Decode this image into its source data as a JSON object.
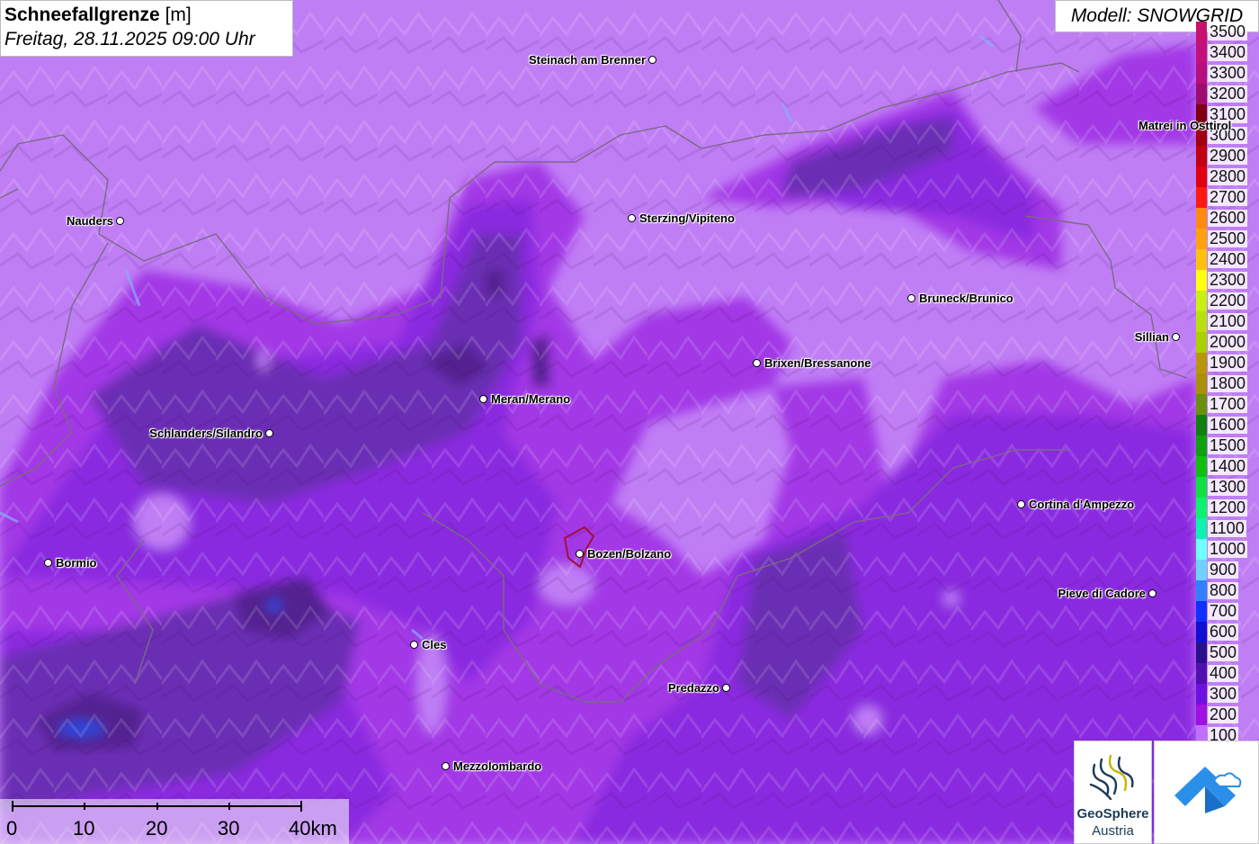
{
  "title": {
    "bold": "Schneefallgrenze",
    "unit": " [m]",
    "datetime": "Freitag, 28.11.2025 09:00 Uhr"
  },
  "model": "Modell: SNOWGRID",
  "legend": [
    {
      "label": "3500",
      "color": "#c8106e"
    },
    {
      "label": "3400",
      "color": "#c4107a"
    },
    {
      "label": "3300",
      "color": "#b60e7c"
    },
    {
      "label": "3200",
      "color": "#9c0c6e"
    },
    {
      "label": "3100",
      "color": "#7e0010"
    },
    {
      "label": "3000",
      "color": "#a00010"
    },
    {
      "label": "2900",
      "color": "#c00010"
    },
    {
      "label": "2800",
      "color": "#e00010"
    },
    {
      "label": "2700",
      "color": "#ff1a10"
    },
    {
      "label": "2600",
      "color": "#ff8a10"
    },
    {
      "label": "2500",
      "color": "#ffa010"
    },
    {
      "label": "2400",
      "color": "#ffc010"
    },
    {
      "label": "2300",
      "color": "#ffff10"
    },
    {
      "label": "2200",
      "color": "#c8f010"
    },
    {
      "label": "2100",
      "color": "#b8e010"
    },
    {
      "label": "2000",
      "color": "#aad000"
    },
    {
      "label": "1900",
      "color": "#b8960a"
    },
    {
      "label": "1800",
      "color": "#a8900a"
    },
    {
      "label": "1700",
      "color": "#6a9010"
    },
    {
      "label": "1600",
      "color": "#108010"
    },
    {
      "label": "1500",
      "color": "#10a010"
    },
    {
      "label": "1400",
      "color": "#10c010"
    },
    {
      "label": "1300",
      "color": "#10e040"
    },
    {
      "label": "1200",
      "color": "#10f070"
    },
    {
      "label": "1100",
      "color": "#10f0b0"
    },
    {
      "label": "1000",
      "color": "#70ffff"
    },
    {
      "label": "900",
      "color": "#70d0ff"
    },
    {
      "label": "800",
      "color": "#3080ff"
    },
    {
      "label": "700",
      "color": "#1030ff"
    },
    {
      "label": "600",
      "color": "#1010d0"
    },
    {
      "label": "500",
      "color": "#2a108a"
    },
    {
      "label": "400",
      "color": "#5010b0"
    },
    {
      "label": "300",
      "color": "#7010e0"
    },
    {
      "label": "200",
      "color": "#a010e0"
    },
    {
      "label": "100",
      "color": "#c070ff"
    }
  ],
  "cities": [
    {
      "name": "Steinach am Brenner",
      "label_side": "left"
    },
    {
      "name": "Nauders",
      "label_side": "left"
    },
    {
      "name": "Sterzing/Vipiteno",
      "label_side": "right"
    },
    {
      "name": "Bruneck/Brunico",
      "label_side": "right"
    },
    {
      "name": "Matrei in Osttirol",
      "label_side": "left"
    },
    {
      "name": "Sillian",
      "label_side": "left"
    },
    {
      "name": "Brixen/Bressanone",
      "label_side": "right"
    },
    {
      "name": "Meran/Merano",
      "label_side": "right"
    },
    {
      "name": "Schlanders/Silandro",
      "label_side": "left"
    },
    {
      "name": "Cortina d'Ampezzo",
      "label_side": "right"
    },
    {
      "name": "Bozen/Bolzano",
      "label_side": "right"
    },
    {
      "name": "Bormio",
      "label_side": "right"
    },
    {
      "name": "Pieve di Cadore",
      "label_side": "left"
    },
    {
      "name": "Cles",
      "label_side": "right"
    },
    {
      "name": "Predazzo",
      "label_side": "left"
    },
    {
      "name": "Mezzolombardo",
      "label_side": "right"
    }
  ],
  "scale": [
    "0",
    "10",
    "20",
    "30",
    "40km"
  ],
  "logos": {
    "geosphere_line1": "GeoSphere",
    "geosphere_line2": "Austria",
    "geosphere_icon": "geosphere-logo",
    "app_icon": "cloud-arrow-logo"
  },
  "colors": {
    "base": "#c07ef5",
    "band200": "#a23ae6",
    "band300": "#8a2be2",
    "band400": "#6b2cb0",
    "band500": "#4e1f88",
    "band700": "#2a3fd0",
    "border": "#7a6a80",
    "bozen_outline": "#a0103a"
  }
}
